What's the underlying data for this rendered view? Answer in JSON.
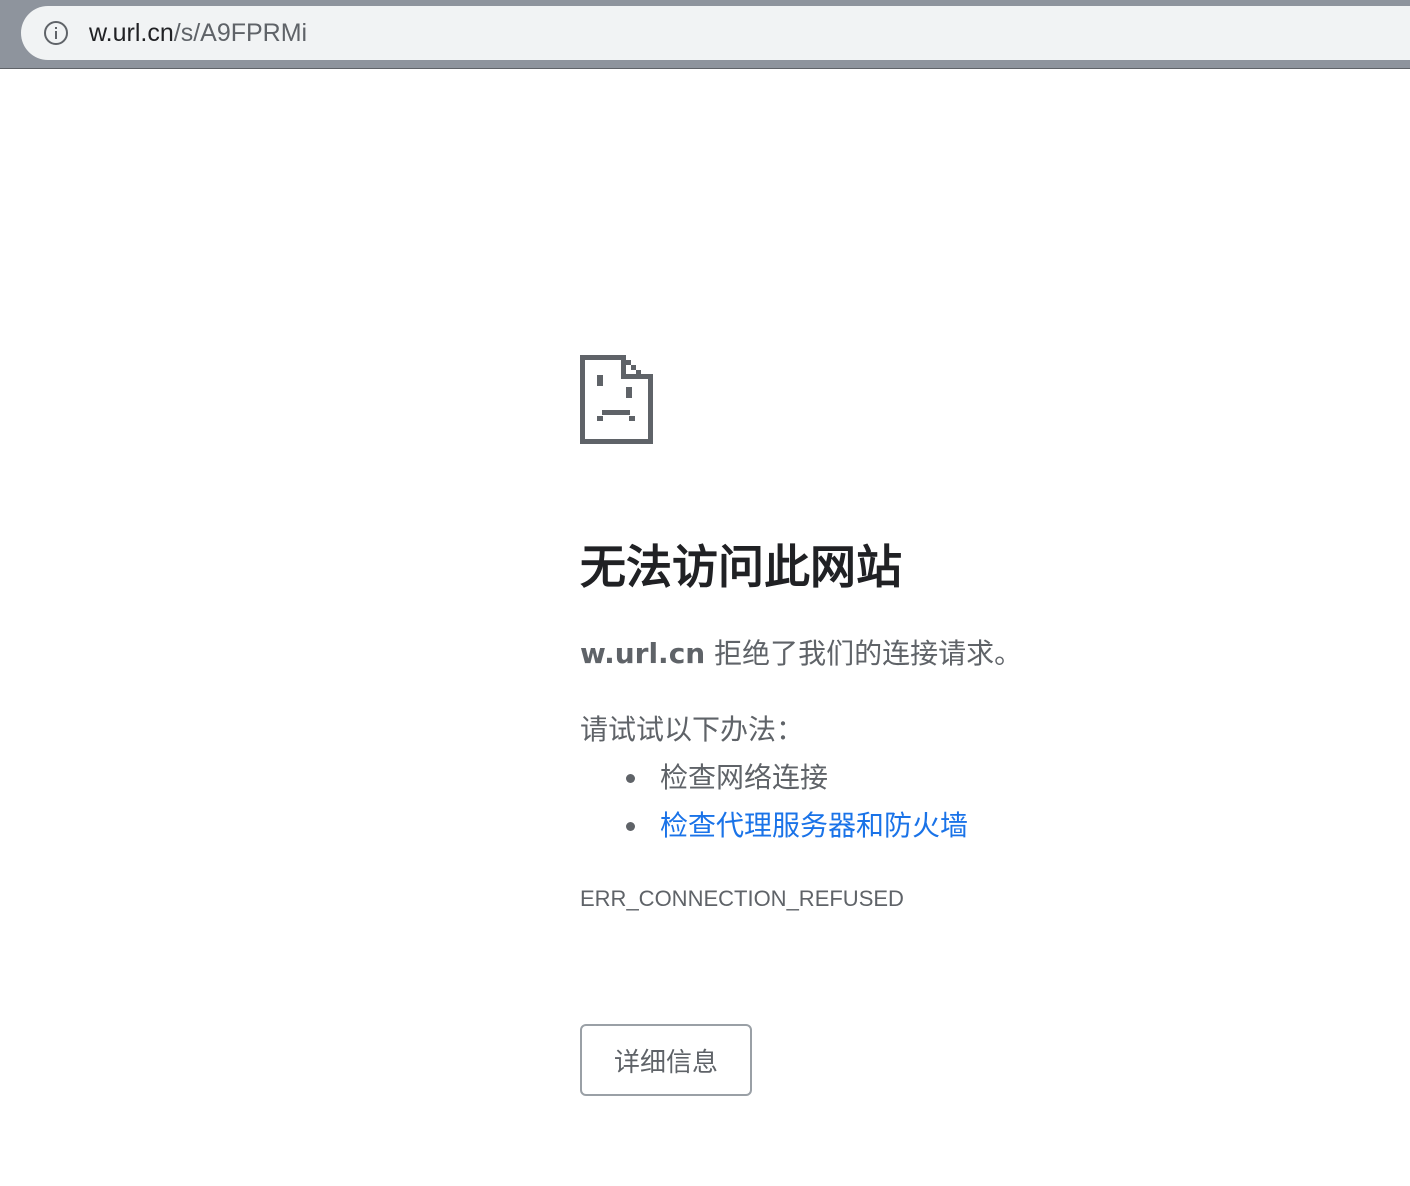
{
  "address_bar": {
    "url_host": "w.url.cn",
    "url_path": "/s/A9FPRMi",
    "info_icon": "info-icon"
  },
  "error_page": {
    "icon": "sad-document-icon",
    "headline": "无法访问此网站",
    "description": {
      "host": "w.url.cn",
      "message": " 拒绝了我们的连接请求。"
    },
    "suggestions_label": "请试试以下办法：",
    "suggestions": [
      {
        "text": "检查网络连接",
        "is_link": false
      },
      {
        "text": "检查代理服务器和防火墙",
        "is_link": true
      }
    ],
    "error_code": "ERR_CONNECTION_REFUSED",
    "details_button_label": "详细信息"
  },
  "colors": {
    "link": "#1a73e8",
    "headline": "#202124",
    "body_text": "#5f6368",
    "chrome_bar": "#8e949d",
    "omnibox_bg": "#f1f3f4"
  }
}
